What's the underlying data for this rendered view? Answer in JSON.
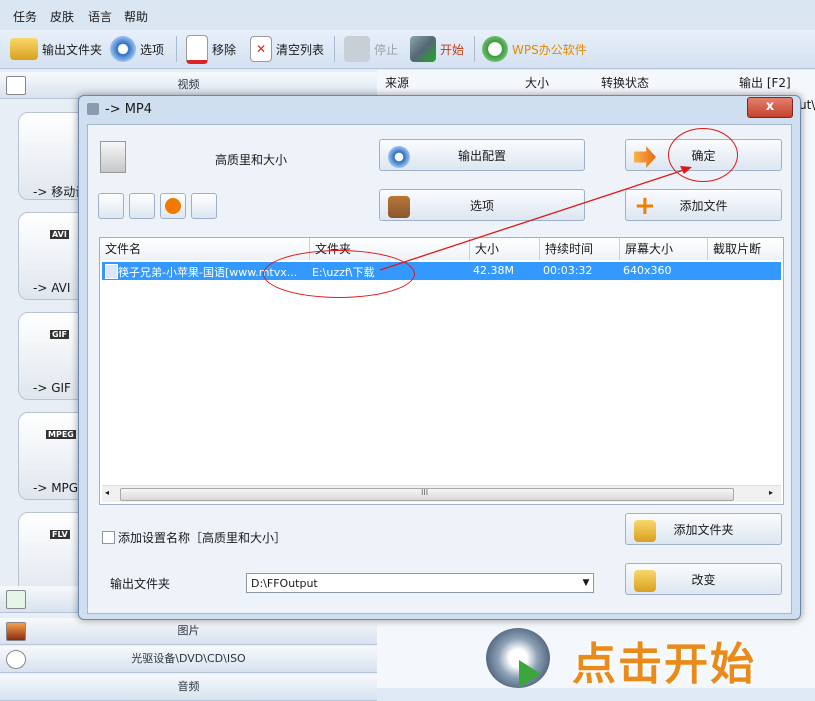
{
  "menu": {
    "items": [
      "任务",
      "皮肤",
      "语言",
      "帮助"
    ]
  },
  "toolbar": {
    "output_folder": "输出文件夹",
    "options": "选项",
    "remove": "移除",
    "clear_list": "清空列表",
    "stop": "停止",
    "start": "开始",
    "wps": "WPS办公软件"
  },
  "left_panel": {
    "video_category": "视频",
    "formats": [
      "-> 移动设",
      "-> AVI",
      "-> GIF",
      "-> MPG"
    ],
    "format_tags": [
      "AVI",
      "GIF",
      "MPEG",
      "FLV"
    ],
    "picture_category": "图片",
    "disc_category": "光驱设备\\DVD\\CD\\ISO",
    "audio_category": "音频"
  },
  "right_panel": {
    "columns": [
      "来源",
      "大小",
      "转换状态",
      "输出 [F2]"
    ],
    "partial_output": "ut\\"
  },
  "start_banner": "点击开始",
  "dialog": {
    "title": "-> MP4",
    "close_label": "x",
    "quality": "高质里和大小",
    "output_config": "输出配置",
    "ok": "确定",
    "options": "选项",
    "add_file": "添加文件",
    "table_headers": [
      "文件名",
      "文件夹",
      "大小",
      "持续时间",
      "屏幕大小",
      "截取片断"
    ],
    "rows": [
      {
        "name": "筷子兄弟-小苹果-国语[www.mtvx...",
        "folder": "E:\\uzzf\\下载",
        "size": "42.38M",
        "duration": "00:03:32",
        "screen": "640x360",
        "clip": ""
      }
    ],
    "scroll_label": "III",
    "add_setting_name": "添加设置名称［高质里和大小］",
    "add_folder": "添加文件夹",
    "output_folder_label": "输出文件夹",
    "output_path": "D:\\FFOutput",
    "change": "改变"
  },
  "colors": {
    "accent": "#3399ff",
    "annotation": "#e01818",
    "start_orange": "#e98a1a"
  }
}
